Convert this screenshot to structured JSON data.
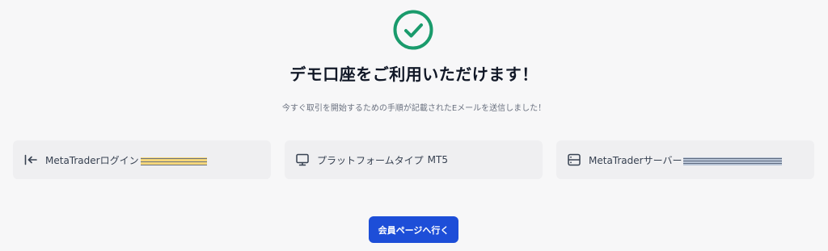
{
  "success": {
    "icon": "check-circle-icon",
    "color": "#1a9b6c"
  },
  "header": {
    "title": "デモ口座をご利用いただけます！",
    "subtitle": "今すぐ取引を開始するための手順が記載されたEメールを送信しました！"
  },
  "cards": [
    {
      "icon": "login-arrow-icon",
      "label": "MetaTraderログイン",
      "value": "",
      "masked": true
    },
    {
      "icon": "monitor-icon",
      "label": "プラットフォームタイプ",
      "value": "MT5",
      "masked": false
    },
    {
      "icon": "server-icon",
      "label": "MetaTraderサーバー",
      "value": "",
      "masked": true
    }
  ],
  "actions": {
    "member_page_label": "会員ページへ行く",
    "button_color": "#1d4ed8"
  }
}
